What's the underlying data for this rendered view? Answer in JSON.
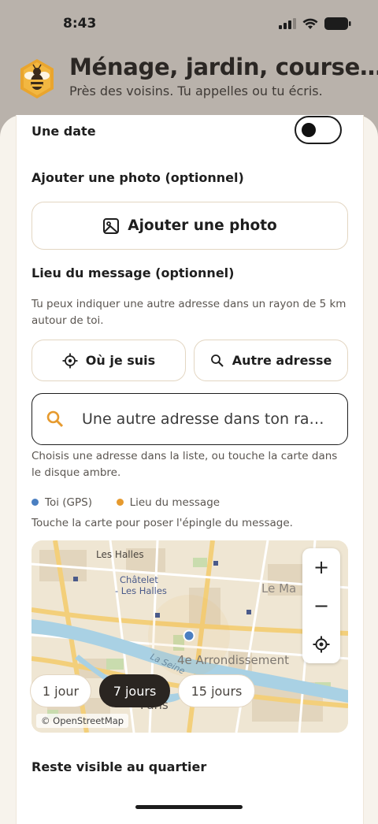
{
  "status_bar": {
    "time": "8:43"
  },
  "header": {
    "title": "Ménage, jardin, course…",
    "subtitle": "Près des voisins. Tu appelles ou tu écris."
  },
  "date_row": {
    "label": "Une date",
    "toggle_on": false
  },
  "photo": {
    "label": "Ajouter une photo (optionnel)",
    "button_label": "Ajouter une photo"
  },
  "location": {
    "label": "Lieu du message (optionnel)",
    "help": "Tu peux indiquer une autre adresse dans un rayon de 5 km autour de toi.",
    "here_button": "Où je suis",
    "other_button": "Autre adresse",
    "search_placeholder": "Une autre adresse dans ton ra…",
    "search_help": "Choisis une adresse dans la liste, ou touche la carte dans le disque ambre.",
    "legend": [
      {
        "label": "Toi (GPS)",
        "color": "#4a7fc1"
      },
      {
        "label": "Lieu du message",
        "color": "#e69a2e"
      }
    ],
    "map_help": "Touche la carte pour poser l'épingle du message."
  },
  "map": {
    "labels": {
      "les_halles": "Les Halles",
      "chatelet": "Châtelet",
      "chatelet2": "- Les Halles",
      "le_marais": "Le Ma",
      "arrondissement": "4e Arrondissement",
      "seine": "La Seine",
      "paris": "Paris"
    },
    "zoom_in": "+",
    "zoom_out": "−",
    "attribution": "© OpenStreetMap"
  },
  "visibility": {
    "label": "Reste visible au quartier",
    "options": [
      "1 jour",
      "7 jours",
      "15 jours"
    ],
    "selected": "7 jours"
  },
  "colors": {
    "accent": "#e69a2e",
    "gps": "#4a7fc1",
    "dark": "#2a2521",
    "border": "#e3d6c2"
  }
}
